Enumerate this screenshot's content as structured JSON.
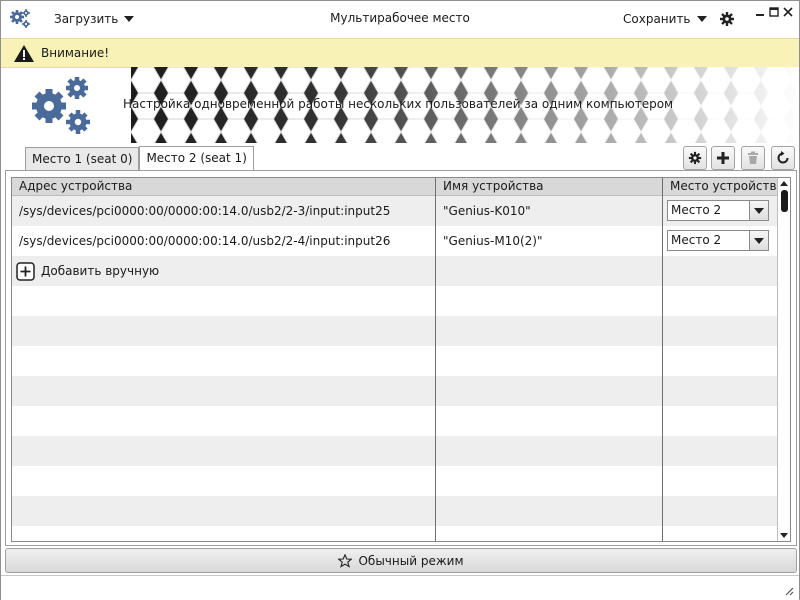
{
  "titlebar": {
    "load_menu": "Загрузить",
    "title": "Мультирабочее место",
    "save_menu": "Сохранить"
  },
  "warning": {
    "text": "Внимание!"
  },
  "banner": {
    "text": "Настройка одновременной работы нескольких пользователей за одним компьютером"
  },
  "tabs": [
    {
      "label": "Место 1 (seat 0)",
      "active": false
    },
    {
      "label": "Место 2 (seat 1)",
      "active": true
    }
  ],
  "toolbar": {
    "settings_icon": "gear-icon",
    "add_icon": "plus-icon",
    "delete_icon": "trash-icon",
    "refresh_icon": "refresh-icon"
  },
  "table": {
    "columns": [
      "Адрес устройства",
      "Имя устройства",
      "Место устройства"
    ],
    "rows": [
      {
        "address": "/sys/devices/pci0000:00/0000:00:14.0/usb2/2-3/input:input25",
        "name": "\"Genius-K010\"",
        "seat": "Место 2"
      },
      {
        "address": "/sys/devices/pci0000:00/0000:00:14.0/usb2/2-4/input:input26",
        "name": "\"Genius-M10(2)\"",
        "seat": "Место 2"
      }
    ],
    "add_manual": "Добавить вручную"
  },
  "mode_button": {
    "label": "Обычный режим"
  },
  "colors": {
    "accent": "#4a6a99",
    "warning_bg": "#f8f2b6"
  }
}
